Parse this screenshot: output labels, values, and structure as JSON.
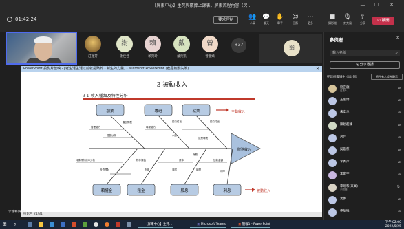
{
  "window": {
    "title": "【屏東中心】生死與殯葬上課表，屏東流程內容（另…",
    "minimize": "—",
    "maximize": "☐",
    "close": "✕"
  },
  "toolbar": {
    "timer": "01:42:24",
    "control_button": "要求控制",
    "items": [
      {
        "label": "人員",
        "icon": "people-icon"
      },
      {
        "label": "聊天",
        "icon": "chat-icon"
      },
      {
        "label": "舉手",
        "icon": "raise-hand-icon"
      },
      {
        "label": "回應",
        "icon": "reaction-icon"
      },
      {
        "label": "檢視",
        "icon": "view-icon"
      },
      {
        "label": "更多",
        "icon": "more-icon"
      },
      {
        "label": "攝影機",
        "icon": "camera-icon"
      },
      {
        "label": "麥克風",
        "icon": "mic-icon"
      },
      {
        "label": "分享",
        "icon": "share-icon"
      }
    ],
    "leave": "離開"
  },
  "strip": {
    "participants": [
      {
        "glyph": "",
        "name": "莊雅芳",
        "color": "#c9a06a",
        "photo": true
      },
      {
        "glyph": "謝",
        "name": "謝佳佳",
        "color": "#e0e6c8"
      },
      {
        "glyph": "賴",
        "name": "賴宛玲",
        "color": "#e7d3d1"
      },
      {
        "glyph": "戴",
        "name": "戴元凱",
        "color": "#d7e3bf"
      },
      {
        "glyph": "曾",
        "name": "曾麗嬌",
        "color": "#f0d9c8"
      }
    ],
    "more_count": "+37",
    "featured_glyph": "翁"
  },
  "share": {
    "app_title": "PowerPoint 投影片放映 - [老生活生活以前就是殯葬 - 新生的力量] - Microsoft PowerPoint (產品啟動失敗)",
    "slide_title": "3 被動收入",
    "section": "3-1 收入種類及特性分析",
    "active_income": "主動收入",
    "passive_income": "被動收入",
    "top_boxes": [
      "創業",
      "專班",
      "就業"
    ],
    "bottom_boxes": [
      "賴權金",
      "租金",
      "股息",
      "利息"
    ],
    "head": "財務收入",
    "ribs": [
      "產品開發",
      "管理能力",
      "經營伙伴",
      "勞力付出",
      "專業能力",
      "人脈",
      "勞力付出",
      "就業環境",
      "特殊資材成本分析",
      "投資理財",
      "物件價值",
      "判斷",
      "資本",
      "風險",
      "時間",
      "放款金額",
      "利率",
      "財務"
    ],
    "status": "投影片 21/31"
  },
  "panel": {
    "heading": "參與者",
    "search_placeholder": "輸入名稱",
    "share_invite": "分享邀請",
    "section": "在這個會議中 (44 個)",
    "mute_all": "將所有人設為靜音",
    "people": [
      {
        "name": "劉宜龍",
        "role": "召集人",
        "color": "#d6c49a"
      },
      {
        "name": "王俊博",
        "role": "",
        "color": "#bcc7e5"
      },
      {
        "name": "朱奕丞",
        "role": "",
        "color": "#bcc7e5"
      },
      {
        "name": "陳建超榛",
        "role": "",
        "color": "#cfd8c4"
      },
      {
        "name": "呂佳",
        "role": "",
        "color": "#bcc7e5"
      },
      {
        "name": "吳晨慈",
        "role": "",
        "color": "#bcc7e5"
      },
      {
        "name": "李秀萍",
        "role": "",
        "color": "#bcc7e5"
      },
      {
        "name": "李寶宇",
        "role": "",
        "color": "#c9b7e0"
      },
      {
        "name": "李瑞和(來賓)",
        "role": "未驗證",
        "color": "#d8d2c3"
      },
      {
        "name": "沈夢",
        "role": "",
        "color": "#bcc7e5"
      },
      {
        "name": "申語祥",
        "role": "",
        "color": "#bcc7e5"
      }
    ]
  },
  "selfview_label": "李瑞和(來賓)",
  "taskbar": {
    "search": "搜尋",
    "apps": [
      "【屏東中心】生死…",
      "Microsoft Teams",
      "簡報1 - PowerPoint"
    ],
    "time": "下午 02:00",
    "date": "2022/5/25"
  }
}
